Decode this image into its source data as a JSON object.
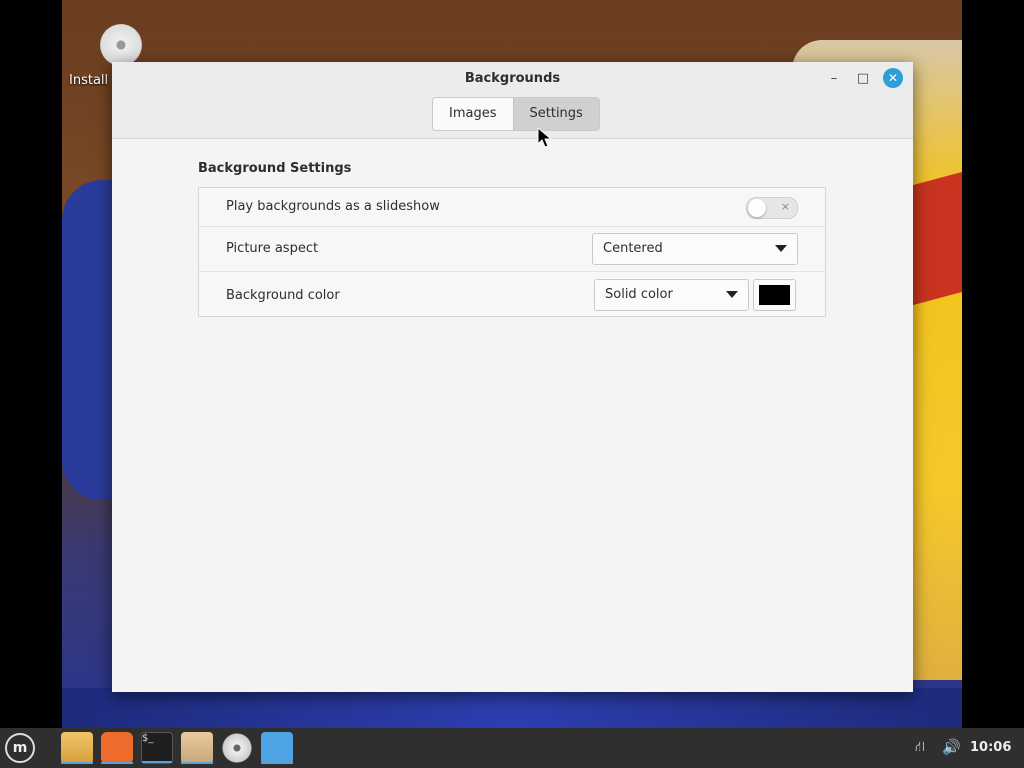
{
  "desktop": {
    "icon_label": "Install"
  },
  "window": {
    "title": "Backgrounds",
    "controls": {
      "minimize": "–",
      "maximize": "□",
      "close": "✕"
    },
    "tabs": [
      {
        "label": "Images",
        "active": false
      },
      {
        "label": "Settings",
        "active": true
      }
    ]
  },
  "settings": {
    "section_title": "Background Settings",
    "slideshow": {
      "label": "Play backgrounds as a slideshow",
      "enabled": false,
      "toggle_glyph": "×"
    },
    "picture_aspect": {
      "label": "Picture aspect",
      "value": "Centered"
    },
    "background_color": {
      "label": "Background color",
      "mode": "Solid color",
      "color": "#000000"
    }
  },
  "taskbar": {
    "menu_glyph": "m",
    "apps": [
      "files-icon",
      "firefox-icon",
      "terminal-icon",
      "archive-icon",
      "disc-icon",
      "settings-icon"
    ],
    "terminal_glyph": "$_",
    "tray_network": "⛙",
    "tray_volume": "🔊",
    "clock": "10:06"
  },
  "colors": {
    "accent": "#2a9fd8",
    "taskbar": "#2f2f2f"
  }
}
